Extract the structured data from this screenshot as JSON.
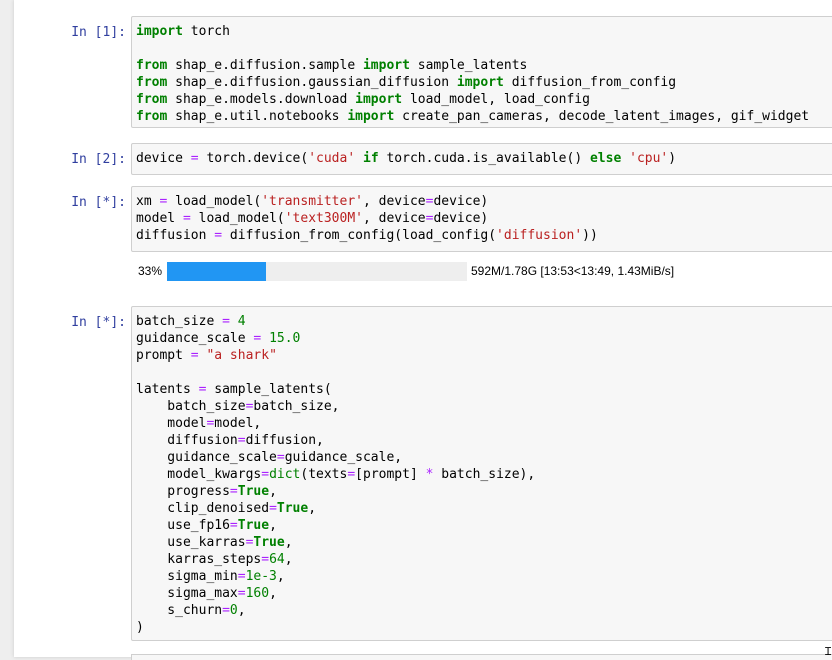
{
  "cells": [
    {
      "prompt": "In [1]:",
      "lines": [
        [
          [
            "kw",
            "import"
          ],
          [
            "p",
            " torch"
          ]
        ],
        [],
        [
          [
            "kw",
            "from"
          ],
          [
            "p",
            " shap_e.diffusion.sample "
          ],
          [
            "kw",
            "import"
          ],
          [
            "p",
            " sample_latents"
          ]
        ],
        [
          [
            "kw",
            "from"
          ],
          [
            "p",
            " shap_e.diffusion.gaussian_diffusion "
          ],
          [
            "kw",
            "import"
          ],
          [
            "p",
            " diffusion_from_config"
          ]
        ],
        [
          [
            "kw",
            "from"
          ],
          [
            "p",
            " shap_e.models.download "
          ],
          [
            "kw",
            "import"
          ],
          [
            "p",
            " load_model, load_config"
          ]
        ],
        [
          [
            "kw",
            "from"
          ],
          [
            "p",
            " shap_e.util.notebooks "
          ],
          [
            "kw",
            "import"
          ],
          [
            "p",
            " create_pan_cameras, decode_latent_images, gif_widget"
          ]
        ]
      ]
    },
    {
      "prompt": "In [2]:",
      "lines": [
        [
          [
            "p",
            "device "
          ],
          [
            "op",
            "="
          ],
          [
            "p",
            " torch.device("
          ],
          [
            "str",
            "'cuda'"
          ],
          [
            "p",
            " "
          ],
          [
            "kw",
            "if"
          ],
          [
            "p",
            " torch.cuda.is_available() "
          ],
          [
            "kw",
            "else"
          ],
          [
            "p",
            " "
          ],
          [
            "str",
            "'cpu'"
          ],
          [
            "p",
            ")"
          ]
        ]
      ]
    },
    {
      "prompt": "In [*]:",
      "lines": [
        [
          [
            "p",
            "xm "
          ],
          [
            "op",
            "="
          ],
          [
            "p",
            " load_model("
          ],
          [
            "str",
            "'transmitter'"
          ],
          [
            "p",
            ", device"
          ],
          [
            "op",
            "="
          ],
          [
            "p",
            "device)"
          ]
        ],
        [
          [
            "p",
            "model "
          ],
          [
            "op",
            "="
          ],
          [
            "p",
            " load_model("
          ],
          [
            "str",
            "'text300M'"
          ],
          [
            "p",
            ", device"
          ],
          [
            "op",
            "="
          ],
          [
            "p",
            "device)"
          ]
        ],
        [
          [
            "p",
            "diffusion "
          ],
          [
            "op",
            "="
          ],
          [
            "p",
            " diffusion_from_config(load_config("
          ],
          [
            "str",
            "'diffusion'"
          ],
          [
            "p",
            "))"
          ]
        ]
      ]
    },
    {
      "prompt": "In [*]:",
      "lines": [
        [
          [
            "p",
            "batch_size "
          ],
          [
            "op",
            "="
          ],
          [
            "p",
            " "
          ],
          [
            "num",
            "4"
          ]
        ],
        [
          [
            "p",
            "guidance_scale "
          ],
          [
            "op",
            "="
          ],
          [
            "p",
            " "
          ],
          [
            "num",
            "15.0"
          ]
        ],
        [
          [
            "p",
            "prompt "
          ],
          [
            "op",
            "="
          ],
          [
            "p",
            " "
          ],
          [
            "str",
            "\"a shark\""
          ]
        ],
        [],
        [
          [
            "p",
            "latents "
          ],
          [
            "op",
            "="
          ],
          [
            "p",
            " sample_latents("
          ]
        ],
        [
          [
            "p",
            "    batch_size"
          ],
          [
            "op",
            "="
          ],
          [
            "p",
            "batch_size,"
          ]
        ],
        [
          [
            "p",
            "    model"
          ],
          [
            "op",
            "="
          ],
          [
            "p",
            "model,"
          ]
        ],
        [
          [
            "p",
            "    diffusion"
          ],
          [
            "op",
            "="
          ],
          [
            "p",
            "diffusion,"
          ]
        ],
        [
          [
            "p",
            "    guidance_scale"
          ],
          [
            "op",
            "="
          ],
          [
            "p",
            "guidance_scale,"
          ]
        ],
        [
          [
            "p",
            "    model_kwargs"
          ],
          [
            "op",
            "="
          ],
          [
            "bi",
            "dict"
          ],
          [
            "p",
            "(texts"
          ],
          [
            "op",
            "="
          ],
          [
            "p",
            "[prompt] "
          ],
          [
            "op",
            "*"
          ],
          [
            "p",
            " batch_size),"
          ]
        ],
        [
          [
            "p",
            "    progress"
          ],
          [
            "op",
            "="
          ],
          [
            "kw",
            "True"
          ],
          [
            "p",
            ","
          ]
        ],
        [
          [
            "p",
            "    clip_denoised"
          ],
          [
            "op",
            "="
          ],
          [
            "kw",
            "True"
          ],
          [
            "p",
            ","
          ]
        ],
        [
          [
            "p",
            "    use_fp16"
          ],
          [
            "op",
            "="
          ],
          [
            "kw",
            "True"
          ],
          [
            "p",
            ","
          ]
        ],
        [
          [
            "p",
            "    use_karras"
          ],
          [
            "op",
            "="
          ],
          [
            "kw",
            "True"
          ],
          [
            "p",
            ","
          ]
        ],
        [
          [
            "p",
            "    karras_steps"
          ],
          [
            "op",
            "="
          ],
          [
            "num",
            "64"
          ],
          [
            "p",
            ","
          ]
        ],
        [
          [
            "p",
            "    sigma_min"
          ],
          [
            "op",
            "="
          ],
          [
            "num",
            "1e-3"
          ],
          [
            "p",
            ","
          ]
        ],
        [
          [
            "p",
            "    sigma_max"
          ],
          [
            "op",
            "="
          ],
          [
            "num",
            "160"
          ],
          [
            "p",
            ","
          ]
        ],
        [
          [
            "p",
            "    s_churn"
          ],
          [
            "op",
            "="
          ],
          [
            "num",
            "0"
          ],
          [
            "p",
            ","
          ]
        ],
        [
          [
            "p",
            ")"
          ]
        ]
      ]
    }
  ],
  "progress": {
    "percent_text": "33%",
    "fraction": 0.33,
    "stats": "592M/1.78G [13:53<13:49, 1.43MiB/s]"
  },
  "colors": {
    "bar_fill": "#2196f3",
    "bar_track": "#eeeeee",
    "prompt": "#303f9f"
  }
}
